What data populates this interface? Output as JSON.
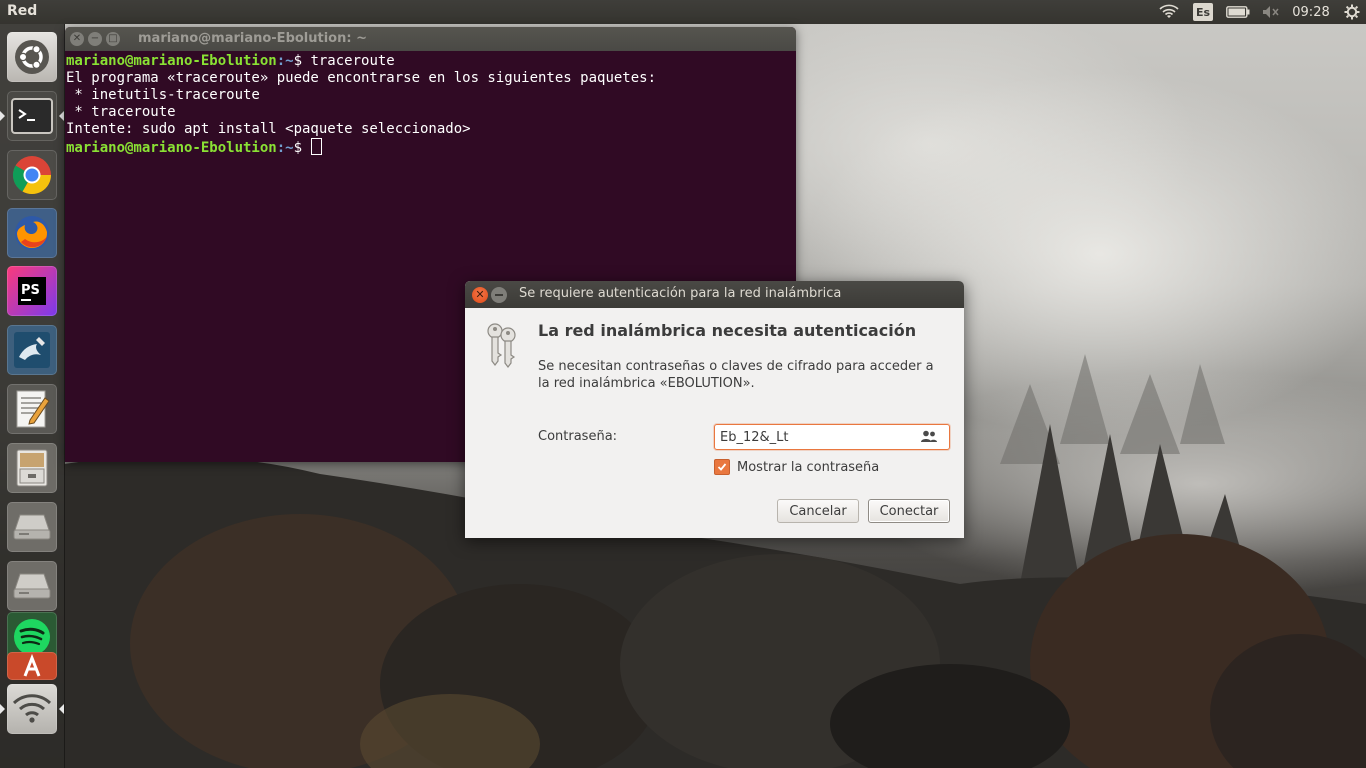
{
  "top_panel": {
    "app_title": "Red",
    "indicators": [
      "wifi-icon",
      "keyboard-language",
      "battery-icon",
      "volume-muted-icon",
      "clock",
      "power-gear-icon"
    ],
    "keyboard_language": "Es",
    "clock": "09:28"
  },
  "launcher": {
    "items": [
      {
        "name": "ubuntu-dash",
        "icon": "ubuntu-logo-icon"
      },
      {
        "name": "terminal",
        "icon": "terminal-icon"
      },
      {
        "name": "chrome",
        "icon": "chrome-icon"
      },
      {
        "name": "firefox",
        "icon": "firefox-icon"
      },
      {
        "name": "phpstorm",
        "icon": "phpstorm-icon",
        "label": "PS"
      },
      {
        "name": "mysql-workbench",
        "icon": "mysql-workbench-icon"
      },
      {
        "name": "text-editor",
        "icon": "text-editor-icon"
      },
      {
        "name": "files",
        "icon": "file-cabinet-icon"
      },
      {
        "name": "drive-1",
        "icon": "hard-drive-icon"
      },
      {
        "name": "drive-2",
        "icon": "hard-drive-icon"
      },
      {
        "name": "spotify",
        "icon": "spotify-icon"
      },
      {
        "name": "software-center",
        "icon": "software-center-icon"
      },
      {
        "name": "network",
        "icon": "wifi-icon"
      }
    ]
  },
  "terminal": {
    "title": "mariano@mariano-Ebolution: ~",
    "prompt_user": "mariano@mariano-Ebolution",
    "prompt_path": ":~",
    "prompt_symbol": "$ ",
    "command": "traceroute",
    "output": [
      "El programa «traceroute» puede encontrarse en los siguientes paquetes:",
      " * inetutils-traceroute",
      " * traceroute",
      "Intente: sudo apt install <paquete seleccionado>"
    ]
  },
  "dialog": {
    "title": "Se requiere autenticación para la red inalámbrica",
    "heading": "La red inalámbrica necesita autenticación",
    "description": "Se necesitan contraseñas o claves de cifrado para acceder a la red inalámbrica «EBOLUTION».",
    "password_label": "Contraseña:",
    "password_value": "Eb_12&_Lt",
    "show_password_label": "Mostrar la contraseña",
    "show_password_checked": true,
    "cancel_label": "Cancelar",
    "connect_label": "Conectar"
  },
  "colors": {
    "terminal_bg": "#300a24",
    "prompt_user": "#8ae234",
    "prompt_path": "#729fcf",
    "accent_orange": "#e9773f",
    "panel_bg": "#3c3b37"
  }
}
